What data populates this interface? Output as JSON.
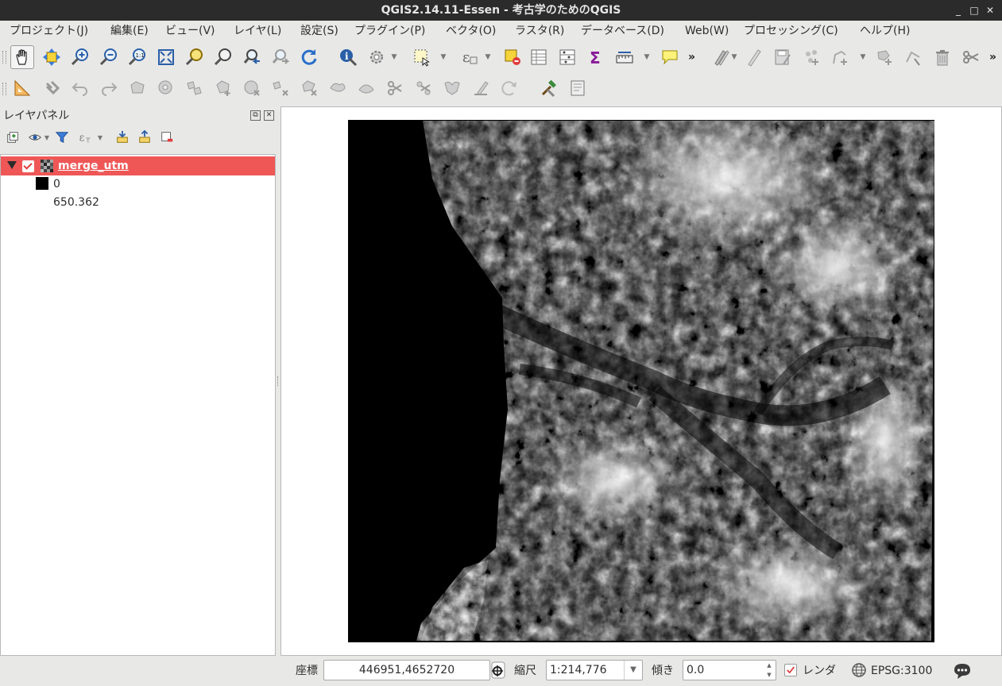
{
  "window": {
    "title": "QGIS2.14.11-Essen - 考古学のためのQGIS",
    "minimize": "_",
    "maximize": "□",
    "close": "✕"
  },
  "menu": [
    "プロジェクト(J)",
    "編集(E)",
    "ビュー(V)",
    "レイヤ(L)",
    "設定(S)",
    "プラグイン(P)",
    "ベクタ(O)",
    "ラスタ(R)",
    "データベース(D)",
    "Web(W)",
    "プロセッシング(C)",
    "ヘルプ(H)"
  ],
  "toolbar": {
    "overflow": "»"
  },
  "layer_panel": {
    "title": "レイヤパネル",
    "float_button": "⧉",
    "close_button": "✕",
    "layers": [
      {
        "name": "merge_utm",
        "visible": true,
        "legend": {
          "min_value": "0",
          "max_value": "650.362",
          "ramp_colors": [
            "#000000",
            "#ffffff"
          ]
        }
      }
    ]
  },
  "statusbar": {
    "coordinate_label": "座標",
    "coordinate_value": "446951,4652720",
    "scale_label": "縮尺",
    "scale_value": "1:214,776",
    "rotation_label": "傾き",
    "rotation_value": "0.0",
    "render_label": "レンダ",
    "render_checked": true,
    "crs_label": "EPSG:3100"
  },
  "colors": {
    "selected_layer_bg": "#ef5757",
    "titlebar_bg": "#2b2b2b",
    "window_bg": "#e8e8e7"
  }
}
